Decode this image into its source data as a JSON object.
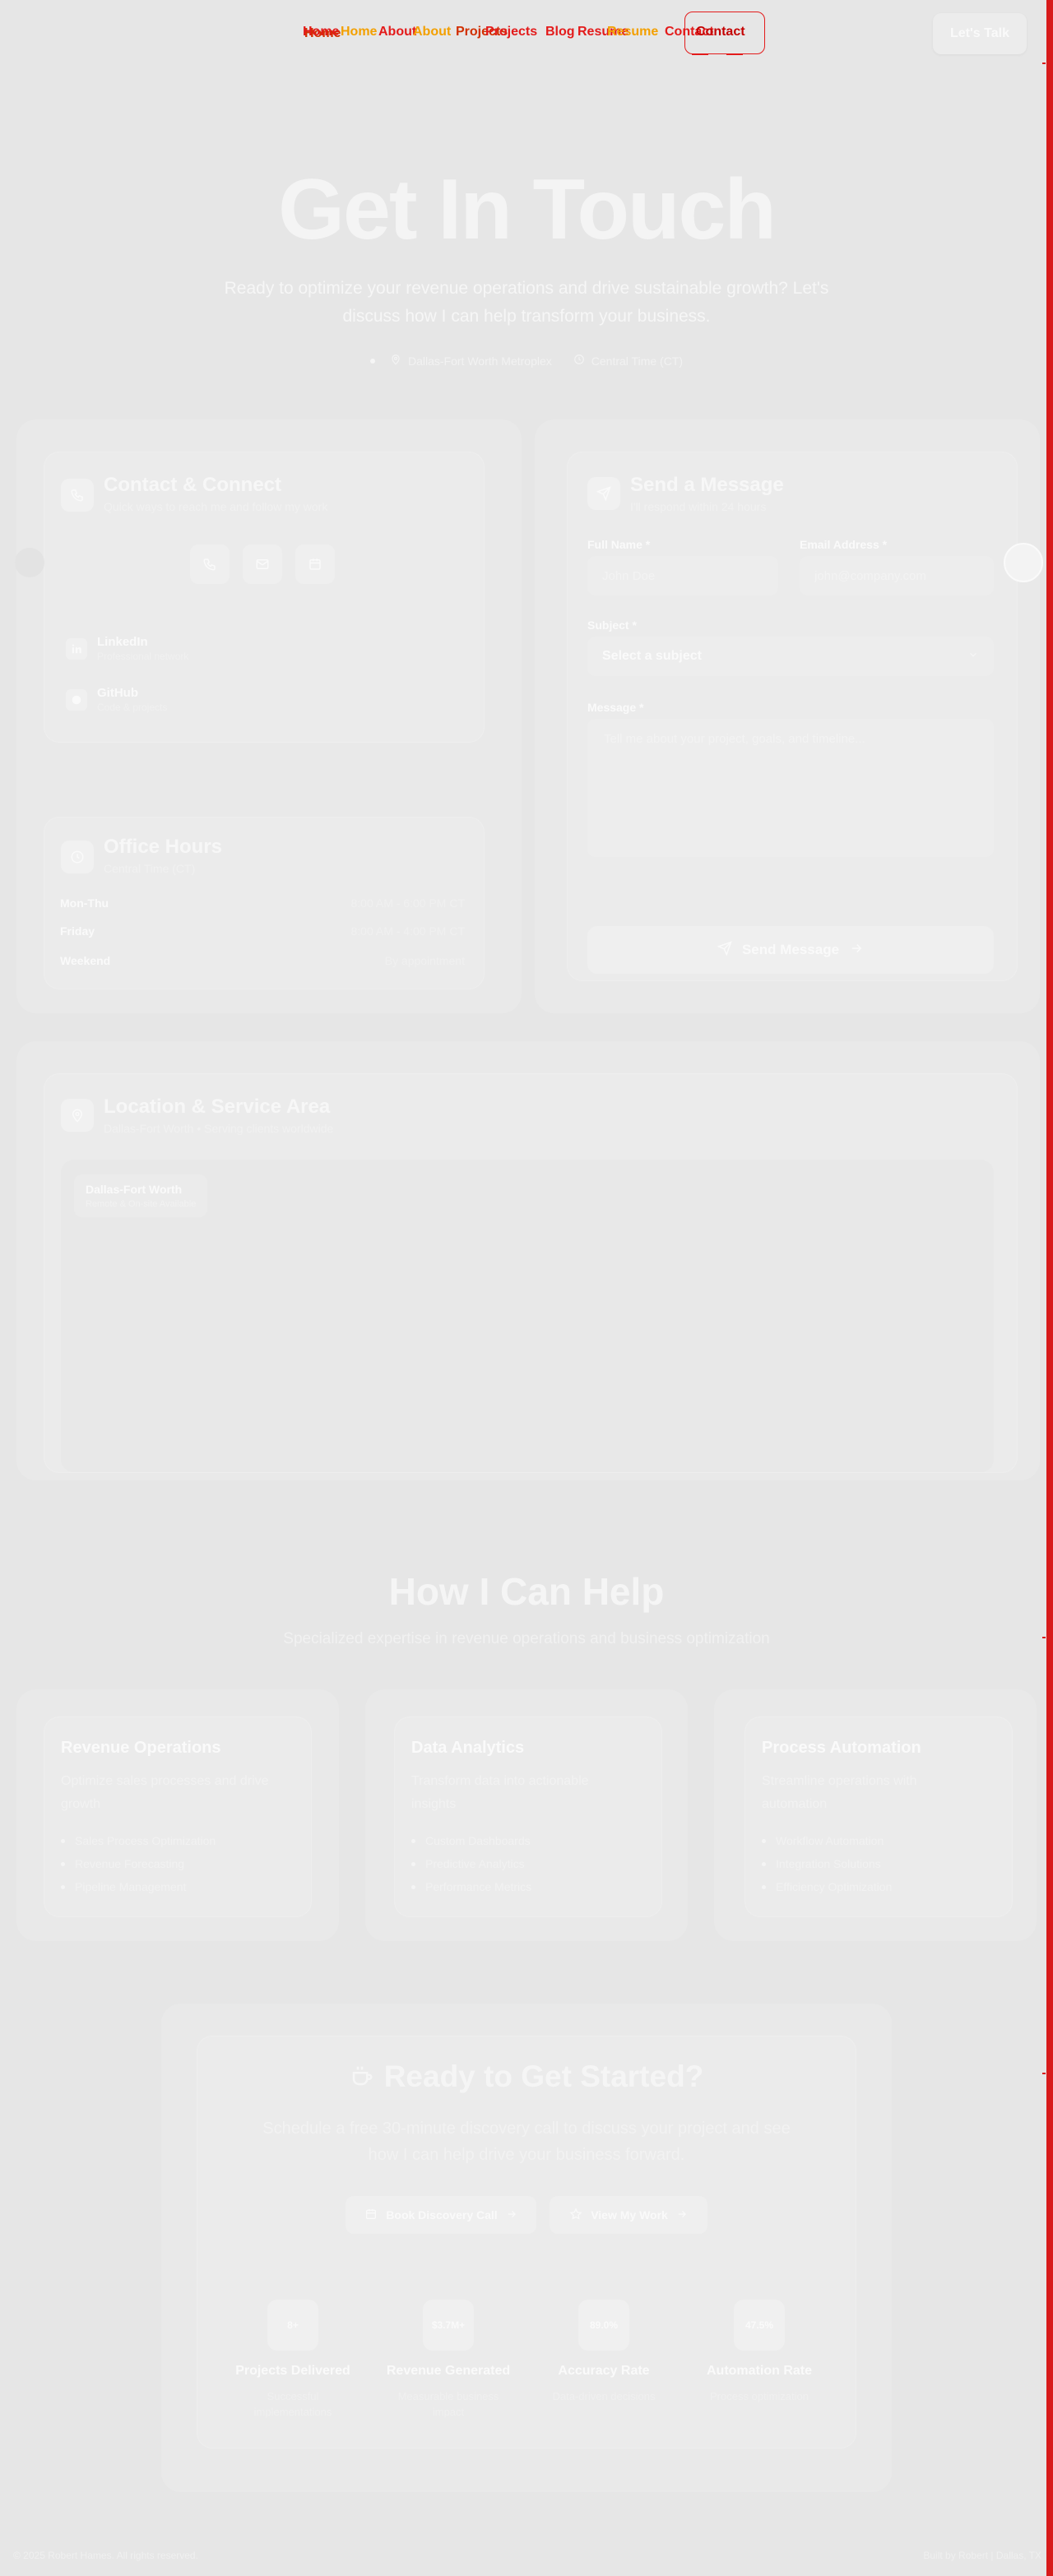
{
  "nav": {
    "links": [
      "Home",
      "About",
      "Projects",
      "Blog",
      "Resume",
      "Contact"
    ],
    "cta": "Let's Talk"
  },
  "hero": {
    "title": "Get In Touch",
    "subtitle": "Ready to optimize your revenue operations and drive sustainable growth? Let's discuss how I can help transform your business.",
    "location": "Dallas-Fort Worth Metroplex",
    "timezone": "Central Time (CT)"
  },
  "contact_card": {
    "title": "Contact & Connect",
    "subtitle": "Quick ways to reach me and follow my work",
    "links": [
      {
        "name": "LinkedIn",
        "sub": "Professional network"
      },
      {
        "name": "GitHub",
        "sub": "Code & projects"
      }
    ]
  },
  "office_hours": {
    "title": "Office Hours",
    "subtitle": "Central Time (CT)",
    "rows": [
      {
        "day": "Mon-Thu",
        "time": "8:00 AM - 6:00 PM CT"
      },
      {
        "day": "Friday",
        "time": "8:00 AM - 4:00 PM CT"
      },
      {
        "day": "Weekend",
        "time": "By appointment"
      }
    ]
  },
  "message_form": {
    "title": "Send a Message",
    "subtitle": "I'll respond within 24 hours",
    "full_name_label": "Full Name *",
    "full_name_placeholder": "John Doe",
    "email_label": "Email Address *",
    "email_placeholder": "john@company.com",
    "subject_label": "Subject *",
    "subject_value": "Select a subject",
    "message_label": "Message *",
    "message_placeholder": "Tell me about your project, goals, and timeline...",
    "submit": "Send Message"
  },
  "location": {
    "title": "Location & Service Area",
    "subtitle": "Dallas-Fort Worth • Serving clients worldwide",
    "pin_title": "Dallas-Fort Worth",
    "pin_sub": "Remote & On-site Available"
  },
  "help": {
    "title": "How I Can Help",
    "subtitle": "Specialized expertise in revenue operations and business optimization",
    "services": [
      {
        "title": "Revenue Operations",
        "desc": "Optimize sales processes and drive growth",
        "items": [
          "Sales Process Optimization",
          "Revenue Forecasting",
          "Pipeline Management"
        ]
      },
      {
        "title": "Data Analytics",
        "desc": "Transform data into actionable insights",
        "items": [
          "Custom Dashboards",
          "Predictive Analytics",
          "Performance Metrics"
        ]
      },
      {
        "title": "Process Automation",
        "desc": "Streamline operations with automation",
        "items": [
          "Workflow Automation",
          "Integration Solutions",
          "Efficiency Optimization"
        ]
      }
    ]
  },
  "cta": {
    "title": "Ready to Get Started?",
    "subtitle": "Schedule a free 30-minute discovery call to discuss your project and see how I can help drive your business forward.",
    "primary": "Book Discovery Call",
    "secondary": "View My Work",
    "stats": [
      {
        "value": "8+",
        "label": "Projects Delivered",
        "sub": "Successful implementations"
      },
      {
        "value": "$3.7M+",
        "label": "Revenue Generated",
        "sub": "Measurable business impact"
      },
      {
        "value": "89.0%",
        "label": "Accuracy Rate",
        "sub": "Data-driven decisions"
      },
      {
        "value": "47.5%",
        "label": "Automation Rate",
        "sub": "Process optimization"
      }
    ]
  },
  "footer": {
    "left": "© 2025 Robert Hames. All rights reserved.",
    "right": "Built by Robert | Dallas, TX"
  }
}
